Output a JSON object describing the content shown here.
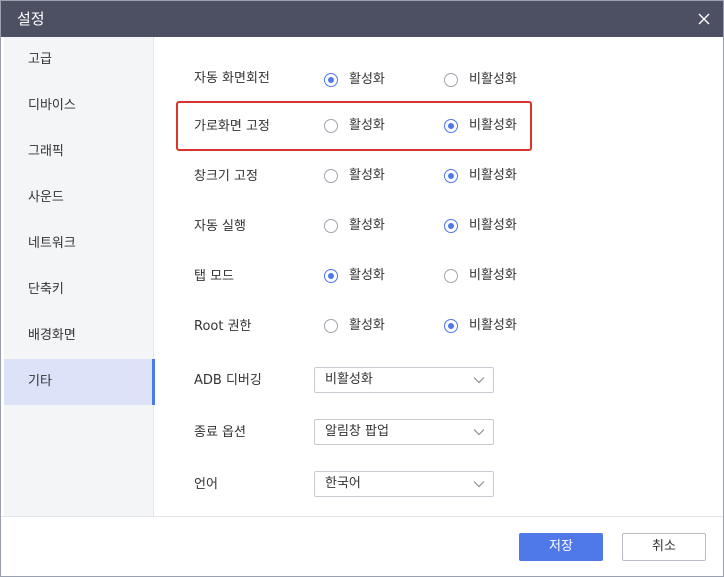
{
  "window": {
    "title": "설정",
    "close_icon": "close-icon"
  },
  "sidebar": {
    "items": [
      {
        "label": "고급"
      },
      {
        "label": "디바이스"
      },
      {
        "label": "그래픽"
      },
      {
        "label": "사운드"
      },
      {
        "label": "네트워크"
      },
      {
        "label": "단축키"
      },
      {
        "label": "배경화면"
      },
      {
        "label": "기타",
        "active": true
      }
    ]
  },
  "settings": {
    "radio_rows": [
      {
        "label": "자동 화면회전",
        "on": "활성화",
        "off": "비활성화",
        "selected": "on"
      },
      {
        "label": "가로화면 고정",
        "on": "활성화",
        "off": "비활성화",
        "selected": "off",
        "highlighted": true
      },
      {
        "label": "창크기 고정",
        "on": "활성화",
        "off": "비활성화",
        "selected": "off"
      },
      {
        "label": "자동 실행",
        "on": "활성화",
        "off": "비활성화",
        "selected": "off"
      },
      {
        "label": "탭 모드",
        "on": "활성화",
        "off": "비활성화",
        "selected": "on"
      },
      {
        "label": "Root 권한",
        "on": "활성화",
        "off": "비활성화",
        "selected": "off"
      }
    ],
    "select_rows": [
      {
        "label": "ADB 디버깅",
        "value": "비활성화"
      },
      {
        "label": "종료 옵션",
        "value": "알림창 팝업"
      },
      {
        "label": "언어",
        "value": "한국어"
      }
    ]
  },
  "footer": {
    "save_label": "저장",
    "cancel_label": "취소"
  },
  "colors": {
    "accent": "#4f78e8",
    "titlebar": "#4c5062",
    "highlight_border": "#d9342b",
    "sidebar_bg": "#f4f5f7",
    "sidebar_active_bg": "#dce3f9"
  }
}
